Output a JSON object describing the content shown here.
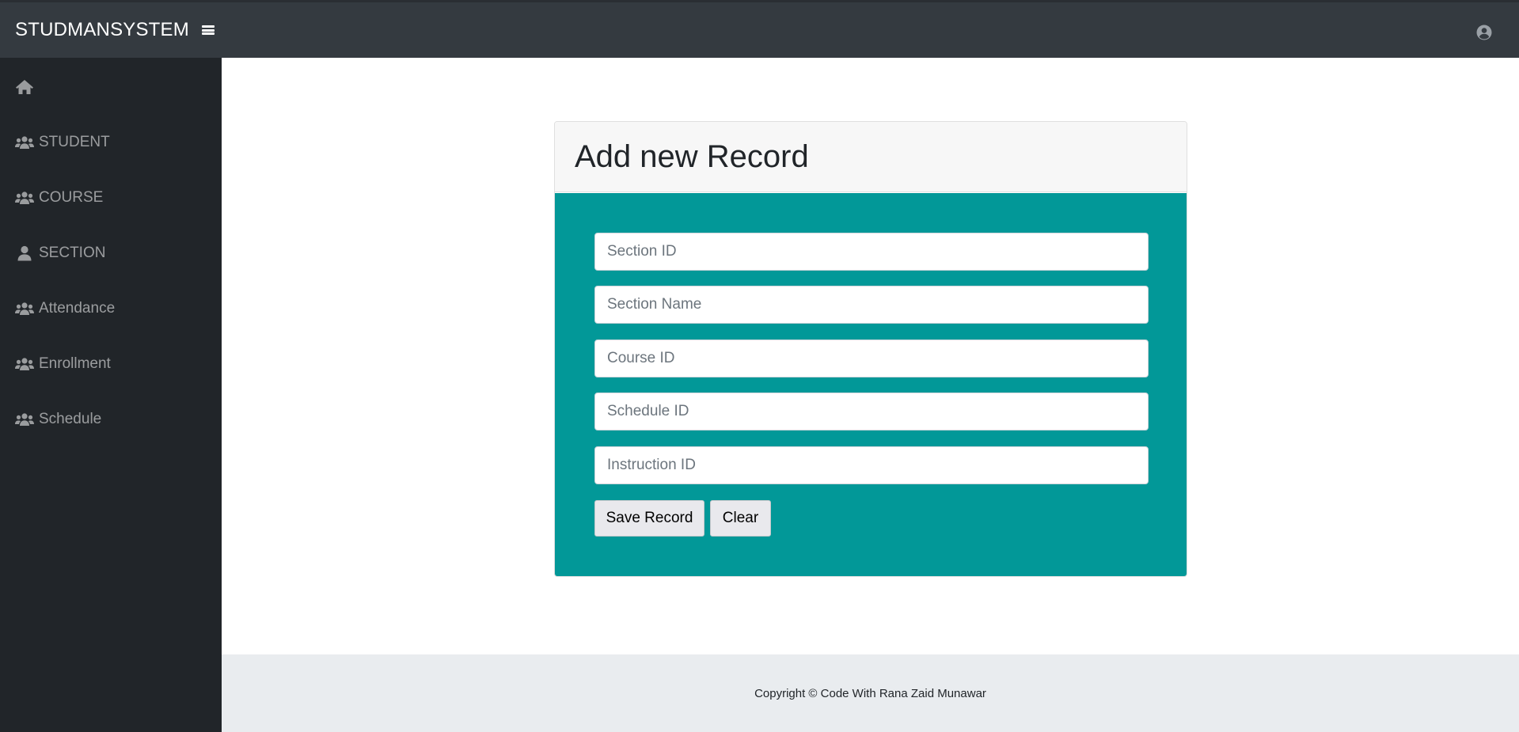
{
  "app": {
    "brand": "STUDMANSYSTEM"
  },
  "topbar": {
    "menu_icon": "bars-icon",
    "user_icon": "user-circle-icon"
  },
  "sidebar": {
    "items": [
      {
        "label": "",
        "icon": "home-icon"
      },
      {
        "label": "STUDENT",
        "icon": "users-icon"
      },
      {
        "label": "COURSE",
        "icon": "users-icon"
      },
      {
        "label": "SECTION",
        "icon": "user-icon"
      },
      {
        "label": "Attendance",
        "icon": "users-icon"
      },
      {
        "label": "Enrollment",
        "icon": "users-icon"
      },
      {
        "label": "Schedule",
        "icon": "users-icon"
      }
    ]
  },
  "form": {
    "title": "Add new Record",
    "fields": [
      {
        "placeholder": "Section ID",
        "value": ""
      },
      {
        "placeholder": "Section Name",
        "value": ""
      },
      {
        "placeholder": "Course ID",
        "value": ""
      },
      {
        "placeholder": "Schedule ID",
        "value": ""
      },
      {
        "placeholder": "Instruction ID",
        "value": ""
      }
    ],
    "save_label": "Save Record",
    "clear_label": "Clear"
  },
  "footer": {
    "text": "Copyright © Code With Rana Zaid Munawar"
  },
  "colors": {
    "topbar": "#343a40",
    "sidebar": "#212529",
    "form_body": "#029898",
    "footer": "#e9ecef"
  }
}
